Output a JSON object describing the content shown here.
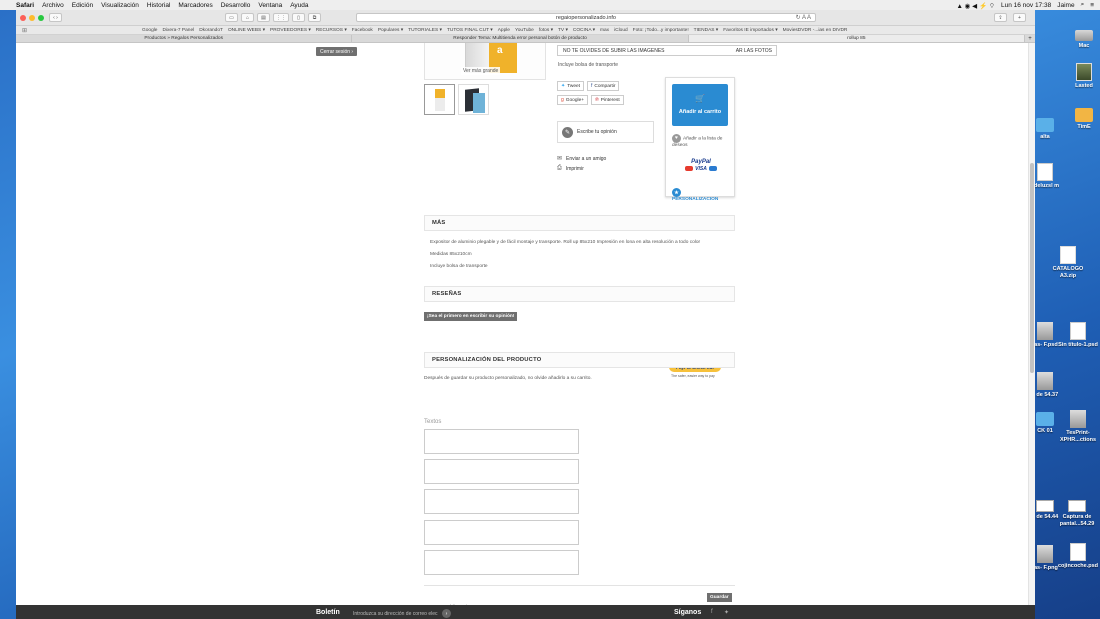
{
  "menubar": {
    "app": "Safari",
    "items": [
      "Archivo",
      "Edición",
      "Visualización",
      "Historial",
      "Marcadores",
      "Desarrollo",
      "Ventana",
      "Ayuda"
    ],
    "clock": "Lun 16 nov  17:38",
    "user": "Jaime"
  },
  "browser": {
    "url": "regaiopersonalizado.info",
    "bookmarks": [
      "Google",
      "Dixera-7 Panel",
      "DkorandoT",
      "ONLINE WEBS ▾",
      "PROVEEDORES ▾",
      "RECURSOS ▾",
      "Facebook",
      "Populares ▾",
      "TUTORIALES ▾",
      "TUTOS FINAL CUT ▾",
      "Apple",
      "YouTube",
      "fotos ▾",
      "TV ▾",
      "COCINA ▾",
      "max",
      "iCloud",
      "Foto: ¡Todo...y importante!",
      "TIENDAS ▾",
      "Favoritos IE importados ▾",
      "MoviesDVDR -...ias en DIVDR"
    ],
    "tabs": [
      {
        "label": "Productos » Regalos Personalizados",
        "active": false
      },
      {
        "label": "Responder Tema: Multitienda error personal botón de producto",
        "active": false
      },
      {
        "label": "rollup 85",
        "active": true
      }
    ]
  },
  "page": {
    "logout_label": "Cerrar sesión",
    "zoom_label": "Ver más grande",
    "notice": "NO TE OLVIDES DE SUBIR LAS IMAGENES",
    "notice_tail": "AR LAS FOTOS",
    "includes": "Incluye bolsa de transporte",
    "share": {
      "tweet": "Tweet",
      "share": "Compartir",
      "google": "Google+",
      "pinterest": "Pinterest"
    },
    "review": "Escribe tu opinión",
    "send_friend": "Enviar a un amigo",
    "print": "Imprimir",
    "cart": {
      "add_label": "Añadir al carrito",
      "wishlist": "Añadir a la lista de deseos",
      "paypal": "PayPal",
      "visa": "VISA",
      "personalization": "PERSONALIZACION"
    },
    "mas_title": "MÁS",
    "mas_lines": [
      "Expositor de aluminio plegable y de fácil montaje y transporte. Roll up 85x210 Impresión en lona en alta resolución a todo color",
      "Medidas 85x210cm",
      "Incluye bolsa de transporte"
    ],
    "reviews_title": "RESEÑAS",
    "first_review": "¡Sea el primero en escribir su opinión!",
    "paypal_checkout": "PayPal Check out",
    "paypal_sub": "The safer, easier way to pay",
    "personalization_title": "PERSONALIZACIÓN DEL PRODUCTO",
    "personalization_note": "Después de guardar su producto personalizado, no olvide añadirlo a su carrito.",
    "textos_label": "Textos",
    "save_label": "Guardar",
    "required_marker": "*",
    "required_note": "campos obligatorios",
    "footer": {
      "boletin": "Boletín",
      "intro": "Introduzca su dirección de correo elec",
      "siguenos": "Síganos"
    }
  },
  "desktop_icons": [
    {
      "label": "Mac",
      "icon": "drive-icon"
    },
    {
      "label": "Lasted",
      "icon": "photo-icon"
    },
    {
      "label": "TimE",
      "icon": "folder-icon"
    },
    {
      "label": "alta",
      "icon": "folder-icon"
    },
    {
      "label": "sdeluzsl m",
      "icon": "doc-icon"
    },
    {
      "label": "CATALOGO A3.zip",
      "icon": "zip-icon"
    },
    {
      "label": "tas- F.psd",
      "icon": "doc-icon"
    },
    {
      "label": "Sin título-1.psd",
      "icon": "doc-icon"
    },
    {
      "label": "a de 54.37",
      "icon": "doc-icon"
    },
    {
      "label": "CK 01",
      "icon": "folder-icon"
    },
    {
      "label": "TesPrint- XPHR...ctions",
      "icon": "doc-icon"
    },
    {
      "label": "a de 54.44",
      "icon": "screenshot-icon"
    },
    {
      "label": "Captura de pantal...54.29",
      "icon": "screenshot-icon"
    },
    {
      "label": "tas- F.png",
      "icon": "doc-icon"
    },
    {
      "label": "cojincoche.psd",
      "icon": "doc-icon"
    }
  ],
  "colors": {
    "accent": "#2a8bd2",
    "dark_button": "#6f6f6f",
    "footer": "#333333",
    "paypal_yellow": "#f7c13b"
  }
}
